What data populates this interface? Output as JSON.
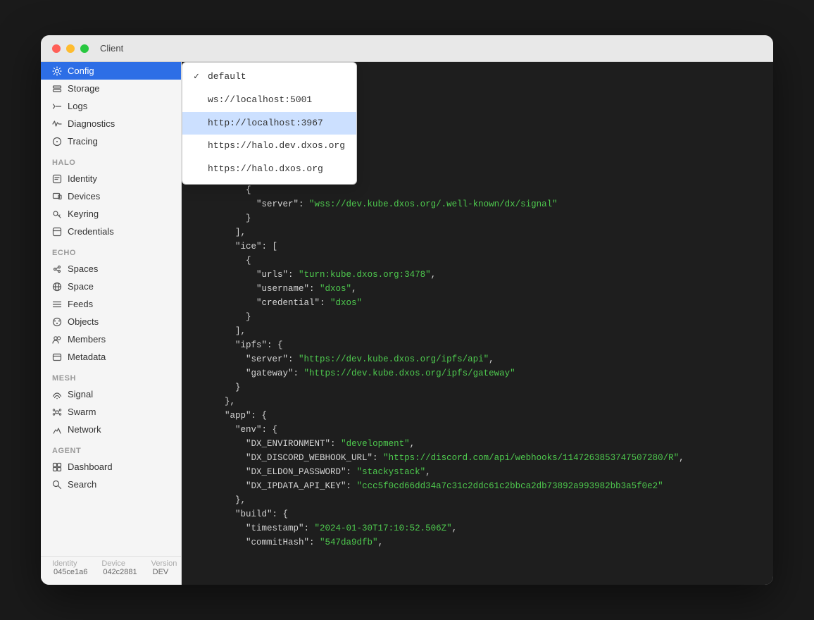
{
  "window": {
    "title": "Client"
  },
  "sidebar": {
    "client_section": {
      "items": [
        {
          "id": "config",
          "label": "Config",
          "icon": "gear",
          "active": true
        },
        {
          "id": "storage",
          "label": "Storage",
          "icon": "storage"
        },
        {
          "id": "logs",
          "label": "Logs",
          "icon": "logs"
        },
        {
          "id": "diagnostics",
          "label": "Diagnostics",
          "icon": "diagnostics"
        },
        {
          "id": "tracing",
          "label": "Tracing",
          "icon": "tracing"
        }
      ]
    },
    "halo_section": {
      "label": "HALO",
      "items": [
        {
          "id": "identity",
          "label": "Identity",
          "icon": "identity"
        },
        {
          "id": "devices",
          "label": "Devices",
          "icon": "devices"
        },
        {
          "id": "keyring",
          "label": "Keyring",
          "icon": "keyring"
        },
        {
          "id": "credentials",
          "label": "Credentials",
          "icon": "credentials"
        }
      ]
    },
    "echo_section": {
      "label": "ECHO",
      "items": [
        {
          "id": "spaces",
          "label": "Spaces",
          "icon": "spaces"
        },
        {
          "id": "space",
          "label": "Space",
          "icon": "space"
        },
        {
          "id": "feeds",
          "label": "Feeds",
          "icon": "feeds"
        },
        {
          "id": "objects",
          "label": "Objects",
          "icon": "objects"
        },
        {
          "id": "members",
          "label": "Members",
          "icon": "members"
        },
        {
          "id": "metadata",
          "label": "Metadata",
          "icon": "metadata"
        }
      ]
    },
    "mesh_section": {
      "label": "MESH",
      "items": [
        {
          "id": "signal",
          "label": "Signal",
          "icon": "signal"
        },
        {
          "id": "swarm",
          "label": "Swarm",
          "icon": "swarm"
        },
        {
          "id": "network",
          "label": "Network",
          "icon": "network"
        }
      ]
    },
    "agent_section": {
      "label": "AGENT",
      "items": [
        {
          "id": "dashboard",
          "label": "Dashboard",
          "icon": "dashboard"
        },
        {
          "id": "search",
          "label": "Search",
          "icon": "search"
        }
      ]
    }
  },
  "dropdown": {
    "items": [
      {
        "id": "default",
        "label": "default",
        "checked": true,
        "selected": false
      },
      {
        "id": "ws-localhost",
        "label": "ws://localhost:5001",
        "checked": false,
        "selected": false
      },
      {
        "id": "http-localhost",
        "label": "http://localhost:3967",
        "checked": false,
        "selected": true
      },
      {
        "id": "https-halo-dev",
        "label": "https://halo.dev.dxos.org",
        "checked": false,
        "selected": false
      },
      {
        "id": "https-halo",
        "label": "https://halo.dxos.org",
        "checked": false,
        "selected": false
      }
    ]
  },
  "footer": {
    "identity_label": "Identity",
    "identity_value": "045ce1a6",
    "device_label": "Device",
    "device_value": "042c2881",
    "version_label": "Version",
    "version_value": "DEV"
  }
}
